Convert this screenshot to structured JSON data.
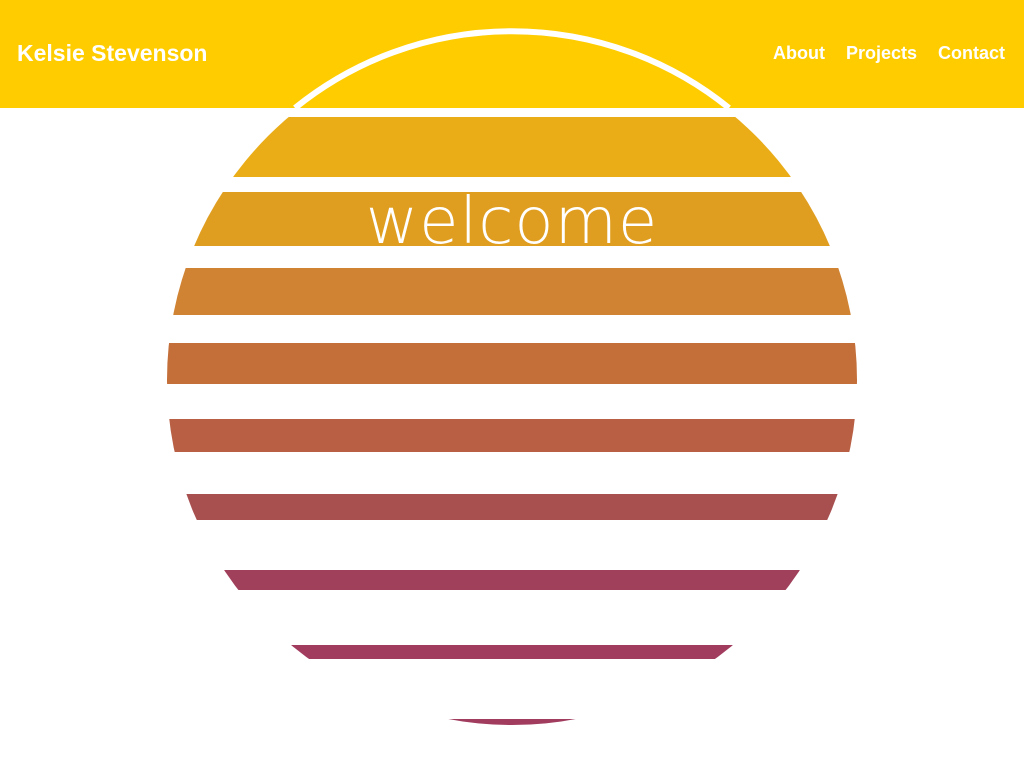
{
  "header": {
    "site_title": "Kelsie Stevenson",
    "background_color": "#ffcc00"
  },
  "nav": {
    "items": [
      {
        "label": "About"
      },
      {
        "label": "Projects"
      },
      {
        "label": "Contact"
      }
    ]
  },
  "hero": {
    "heading": "welcome",
    "stripe_colors": [
      "#eaad17",
      "#e09e21",
      "#d08332",
      "#c46f3a",
      "#b85f44",
      "#a84f50",
      "#a1405b",
      "#a13c5e",
      "#a13c5e"
    ]
  }
}
